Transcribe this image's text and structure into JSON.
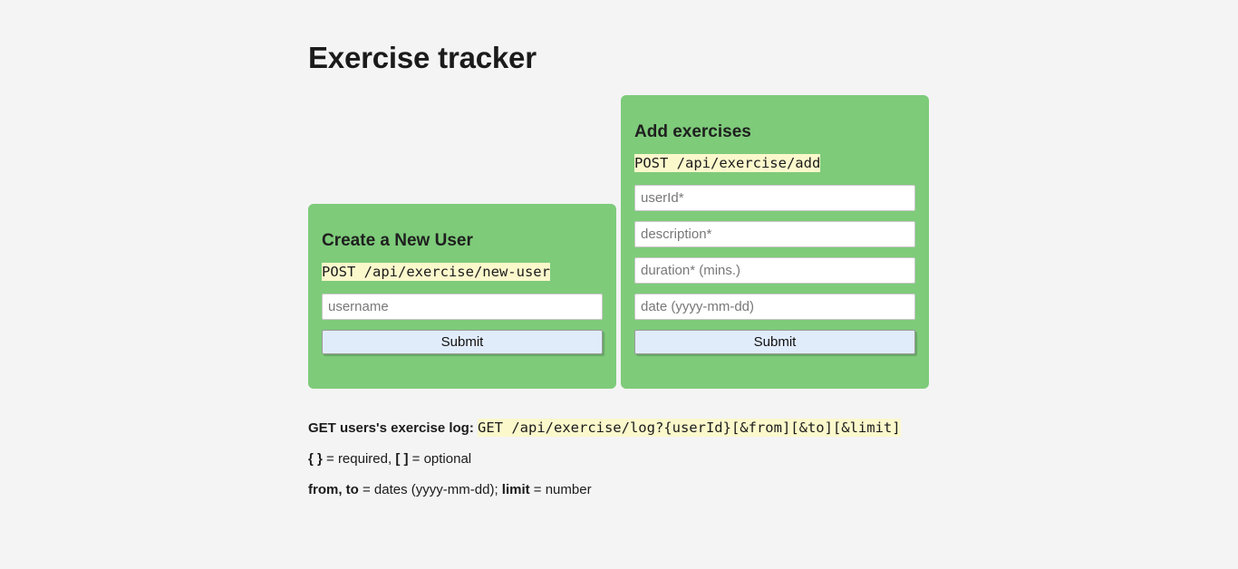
{
  "page": {
    "title": "Exercise tracker",
    "background_color": "#f4f4f4",
    "card_color": "#7ecb7a",
    "code_highlight_color": "#fbf8cc",
    "button_color": "#e1ecfb"
  },
  "create_user_card": {
    "heading": "Create a New User",
    "endpoint": "POST /api/exercise/new-user",
    "fields": [
      {
        "name": "username",
        "placeholder": "username",
        "value": ""
      }
    ],
    "submit_label": "Submit"
  },
  "add_exercises_card": {
    "heading": "Add exercises",
    "endpoint": "POST /api/exercise/add",
    "fields": [
      {
        "name": "userId",
        "placeholder": "userId*",
        "value": ""
      },
      {
        "name": "description",
        "placeholder": "description*",
        "value": ""
      },
      {
        "name": "duration",
        "placeholder": "duration* (mins.)",
        "value": ""
      },
      {
        "name": "date",
        "placeholder": "date (yyyy-mm-dd)",
        "value": ""
      }
    ],
    "submit_label": "Submit"
  },
  "notes": {
    "log_label": "GET users's exercise log:",
    "log_endpoint": "GET /api/exercise/log?{userId}[&from][&to][&limit]",
    "legend_required_symbol": "{ }",
    "legend_required_text": " = required, ",
    "legend_optional_symbol": "[ ]",
    "legend_optional_text": " = optional",
    "params_dates_symbol": "from, to",
    "params_dates_text": " = dates (yyyy-mm-dd); ",
    "params_limit_symbol": "limit",
    "params_limit_text": " = number"
  }
}
